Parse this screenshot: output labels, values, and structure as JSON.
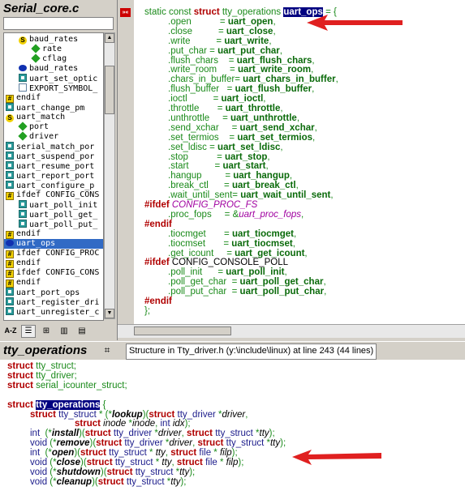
{
  "left_panel": {
    "title": "Serial_core.c",
    "symbols": [
      {
        "icon": "S",
        "label": "baud_rates",
        "indent": 1
      },
      {
        "icon": "dia",
        "label": "rate",
        "indent": 2
      },
      {
        "icon": "dia",
        "label": "cflag",
        "indent": 2
      },
      {
        "icon": "ell",
        "label": "baud_rates",
        "indent": 1
      },
      {
        "icon": "fn",
        "label": "uart_set_optic",
        "indent": 1
      },
      {
        "icon": "doc",
        "label": "EXPORT_SYMBOL_",
        "indent": 1
      },
      {
        "icon": "hash",
        "label": "endif",
        "indent": 0
      },
      {
        "icon": "fn",
        "label": "uart_change_pm",
        "indent": 0
      },
      {
        "icon": "S",
        "label": "uart_match",
        "indent": 0
      },
      {
        "icon": "dia",
        "label": "port",
        "indent": 1
      },
      {
        "icon": "dia",
        "label": "driver",
        "indent": 1
      },
      {
        "icon": "fn",
        "label": "serial_match_por",
        "indent": 0
      },
      {
        "icon": "fn",
        "label": "uart_suspend_por",
        "indent": 0
      },
      {
        "icon": "fn",
        "label": "uart_resume_port",
        "indent": 0
      },
      {
        "icon": "fn",
        "label": "uart_report_port",
        "indent": 0
      },
      {
        "icon": "fn",
        "label": "uart_configure_p",
        "indent": 0
      },
      {
        "icon": "hash",
        "label": "ifdef CONFIG_CONS",
        "indent": 0
      },
      {
        "icon": "fn",
        "label": "uart_poll_init",
        "indent": 1
      },
      {
        "icon": "fn",
        "label": "uart_poll_get_",
        "indent": 1
      },
      {
        "icon": "fn",
        "label": "uart_poll_put_",
        "indent": 1
      },
      {
        "icon": "hash",
        "label": "endif",
        "indent": 0
      },
      {
        "icon": "ell",
        "label": "uart_ops",
        "indent": 0,
        "selected": true
      },
      {
        "icon": "hash",
        "label": "ifdef CONFIG_PROC",
        "indent": 0
      },
      {
        "icon": "hash",
        "label": "endif",
        "indent": 0
      },
      {
        "icon": "hash",
        "label": "ifdef CONFIG_CONS",
        "indent": 0
      },
      {
        "icon": "hash",
        "label": "endif",
        "indent": 0
      },
      {
        "icon": "fn",
        "label": "uart_port_ops",
        "indent": 0
      },
      {
        "icon": "fn",
        "label": "uart_register_dri",
        "indent": 0
      },
      {
        "icon": "fn",
        "label": "uart_unregister_c",
        "indent": 0
      }
    ],
    "toolbar": {
      "az": "A-Z",
      "list": "☰",
      "tree": "⊞",
      "book": "📖",
      "doc": "📄"
    }
  },
  "editor": {
    "gutter_button": "»«",
    "line1": {
      "pre": "static const ",
      "kw": "struct",
      "mid": " tty_operations ",
      "hl": "uart_ops",
      "post": " = {"
    },
    "fields": [
      [
        ".open",
        "uart_open"
      ],
      [
        ".close",
        "uart_close"
      ],
      [
        ".write",
        "uart_write"
      ],
      [
        ".put_char = ",
        "uart_put_char"
      ],
      [
        ".flush_chars",
        "uart_flush_chars"
      ],
      [
        ".write_room",
        "uart_write_room"
      ],
      [
        ".chars_in_buffer= ",
        "uart_chars_in_buffer"
      ],
      [
        ".flush_buffer",
        "uart_flush_buffer"
      ],
      [
        ".ioctl",
        "uart_ioctl"
      ],
      [
        ".throttle",
        "uart_throttle"
      ],
      [
        ".unthrottle",
        "uart_unthrottle"
      ],
      [
        ".send_xchar",
        "uart_send_xchar"
      ],
      [
        ".set_termios",
        "uart_set_termios"
      ],
      [
        ".set_ldisc = ",
        "uart_set_ldisc"
      ],
      [
        ".stop",
        "uart_stop"
      ],
      [
        ".start",
        "uart_start"
      ],
      [
        ".hangup",
        "uart_hangup"
      ],
      [
        ".break_ctl",
        "uart_break_ctl"
      ],
      [
        ".wait_until_sent= ",
        "uart_wait_until_sent"
      ]
    ],
    "ifdef_proc": "#ifdef",
    "config_proc": " CONFIG_PROC_FS",
    "proc_fops_key": ".proc_fops",
    "proc_fops_val": "uart_proc_fops",
    "endif1": "#endif",
    "fields2": [
      [
        ".tiocmget",
        "uart_tiocmget"
      ],
      [
        ".tiocmset",
        "uart_tiocmset"
      ],
      [
        ".get_icount",
        "uart_get_icount"
      ]
    ],
    "ifdef_cons": "#ifdef",
    "config_cons": " CONFIG_CONSOLE_POLL",
    "fields3": [
      [
        ".poll_init",
        "uart_poll_init"
      ],
      [
        ".poll_get_char",
        "uart_poll_get_char"
      ],
      [
        ".poll_put_char",
        "uart_poll_put_char"
      ]
    ],
    "endif2": "#endif",
    "close": "};"
  },
  "middle_bar": {
    "name": "tty_operations",
    "info": "Structure in Tty_driver.h (y:\\include\\linux) at line 243 (44 lines)"
  },
  "bottom": {
    "lines": [
      {
        "kw": "struct",
        "rest": " tty_struct;"
      },
      {
        "kw": "struct",
        "rest": " tty_driver;"
      },
      {
        "kw": "struct",
        "rest": " serial_icounter_struct;"
      },
      {
        "blank": true
      },
      {
        "kw": "struct",
        "hl": "tty_operations",
        "rest": " {"
      }
    ],
    "members": [
      "struct tty_struct * (*lookup)(struct tty_driver *driver,",
      "struct inode *inode, int idx);",
      "int  (*install)(struct tty_driver *driver, struct tty_struct *tty);",
      "void (*remove)(struct tty_driver *driver, struct tty_struct *tty);",
      "int  (*open)(struct tty_struct * tty, struct file * filp);",
      "void (*close)(struct tty_struct * tty, struct file * filp);",
      "void (*shutdown)(struct tty_struct *tty);",
      "void (*cleanup)(struct tty_struct *tty);"
    ]
  },
  "colors": {
    "keyword": "#b00000",
    "function": "#0a6a0a",
    "highlight": "#000080",
    "selection": "#316ac5",
    "arrow": "#e02020"
  }
}
